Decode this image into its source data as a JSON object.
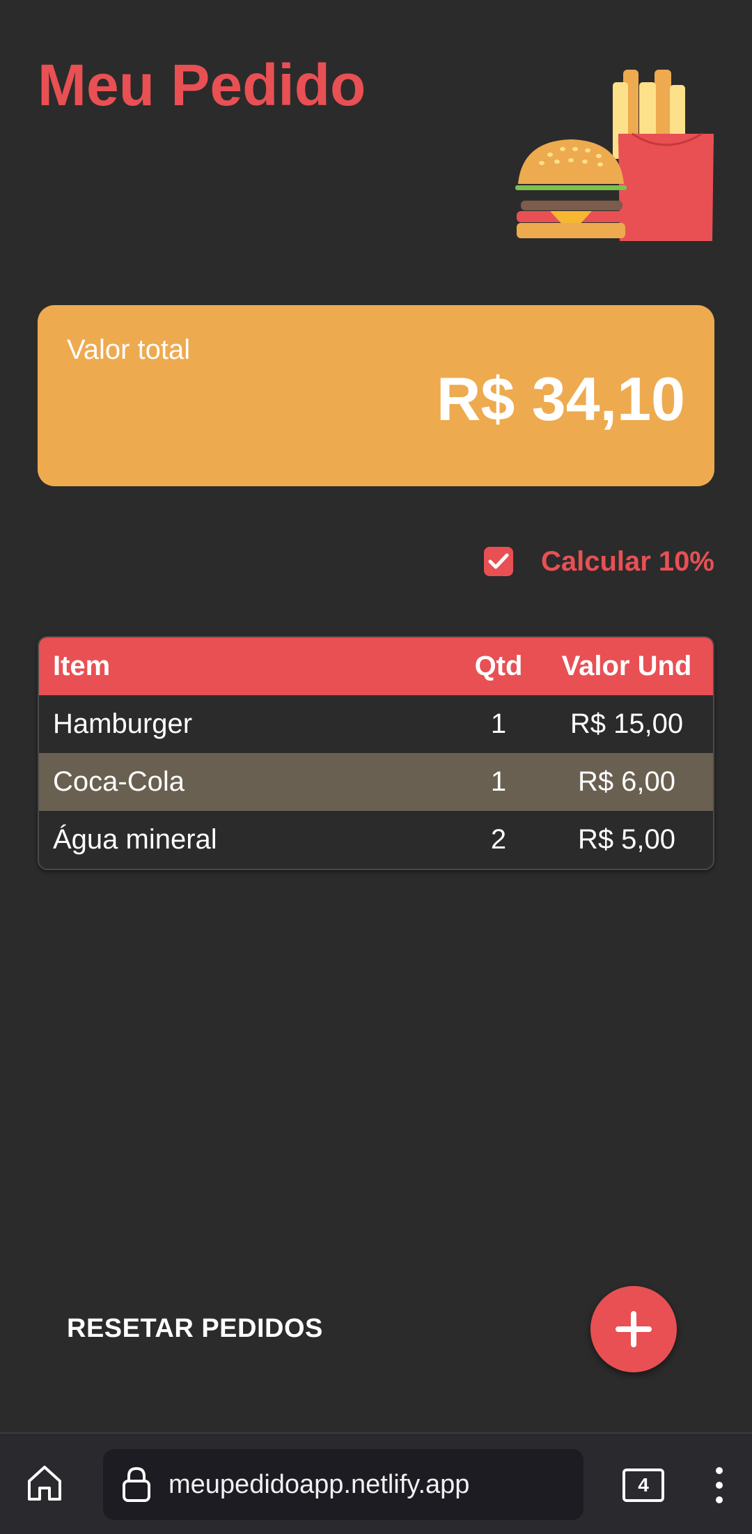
{
  "header": {
    "title": "Meu Pedido"
  },
  "summary": {
    "label": "Valor total",
    "value": "R$ 34,10"
  },
  "options": {
    "service_fee_label": "Calcular 10%",
    "service_fee_checked": true
  },
  "order_table": {
    "headers": [
      "Item",
      "Qtd",
      "Valor Und"
    ],
    "rows": [
      {
        "item": "Hamburger",
        "qty": "1",
        "unit_price": "R$ 15,00"
      },
      {
        "item": "Coca-Cola",
        "qty": "1",
        "unit_price": "R$ 6,00"
      },
      {
        "item": "Água mineral",
        "qty": "2",
        "unit_price": "R$ 5,00"
      }
    ]
  },
  "actions": {
    "reset_label": "RESETAR PEDIDOS",
    "add_icon": "plus-icon"
  },
  "browser": {
    "url": "meupedidoapp.netlify.app",
    "tab_count": "4"
  },
  "colors": {
    "background": "#2b2b2b",
    "accent_red": "#e85054",
    "card_orange": "#eeaa4f",
    "alt_row": "#6a6051"
  }
}
